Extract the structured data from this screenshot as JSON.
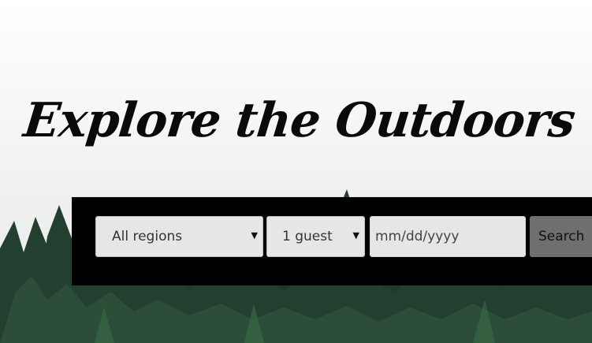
{
  "hero": {
    "headline": "Explore the Outdoors"
  },
  "search": {
    "region_value": "All regions",
    "guests_value": "1 guest",
    "date_placeholder": "mm/dd/yyyy",
    "button_label": "Search"
  },
  "icons": {
    "dropdown_caret": "▼"
  },
  "colors": {
    "search_bar_bg": "#000000",
    "field_bg": "#e6e6e6",
    "button_bg": "#6f6f6f",
    "forest": "#1f3a2c"
  }
}
